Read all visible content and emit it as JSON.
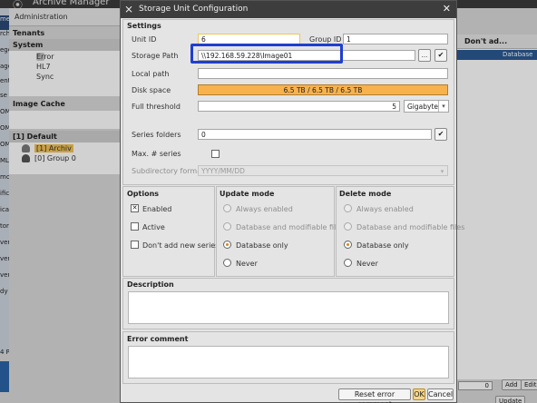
{
  "background": {
    "window_title": "Archive Manager",
    "admin_label": "Administration",
    "left_tabs": [
      "me",
      "rchive",
      "ege",
      "age",
      "ent",
      "se",
      "OM",
      "OM",
      "OM",
      "ML",
      "mor",
      "ific",
      "ica",
      "tor",
      "ver",
      "ver",
      "ver",
      "dy U"
    ],
    "tenants_label": "Tenants",
    "system_label": "System",
    "system_items": [
      "Error",
      "HL7",
      "Sync"
    ],
    "image_cache_label": "Image Cache",
    "default_label": "[1] Default",
    "tree_items": [
      "[1] Archiv",
      "[0] Group 0"
    ],
    "right_column_header": "Don't ad...",
    "right_row_value": "Database ...",
    "bottom_field_value": "0",
    "add_button": "Add",
    "edit_button": "Edit",
    "update_button": "Update",
    "side_fragment": "4 P"
  },
  "dialog": {
    "title": "Storage Unit Configuration",
    "settings": {
      "title": "Settings",
      "unit_id_label": "Unit ID",
      "unit_id_value": "6",
      "group_id_label": "Group ID",
      "group_id_value": "1",
      "storage_path_label": "Storage Path",
      "storage_path_value": "\\\\192.168.59.228\\Image01",
      "browse_button": "...",
      "local_path_label": "Local path",
      "local_path_value": "",
      "disk_space_label": "Disk space",
      "disk_space_value": "6.5 TB / 6.5 TB / 6.5 TB",
      "disk_usage_fraction": 1.0,
      "full_threshold_label": "Full threshold",
      "full_threshold_value": "5",
      "full_threshold_unit": "Gigabyte",
      "series_folders_label": "Series folders",
      "series_folders_value": "0",
      "max_series_label": "Max. # series",
      "subdirectory_format_label": "Subdirectory format",
      "subdirectory_format_value": "YYYY/MM/DD"
    },
    "options": {
      "title": "Options",
      "items": [
        {
          "label": "Enabled",
          "checked": true
        },
        {
          "label": "Active",
          "checked": false
        },
        {
          "label": "Don't add new series",
          "checked": false
        }
      ]
    },
    "update_mode": {
      "title": "Update mode",
      "items": [
        {
          "label": "Always enabled",
          "selected": false,
          "disabled": true
        },
        {
          "label": "Database and modifiable files",
          "selected": false,
          "disabled": true
        },
        {
          "label": "Database only",
          "selected": true,
          "disabled": false
        },
        {
          "label": "Never",
          "selected": false,
          "disabled": false
        }
      ]
    },
    "delete_mode": {
      "title": "Delete mode",
      "items": [
        {
          "label": "Always enabled",
          "selected": false,
          "disabled": true
        },
        {
          "label": "Database and modifiable files",
          "selected": false,
          "disabled": true
        },
        {
          "label": "Database only",
          "selected": true,
          "disabled": false
        },
        {
          "label": "Never",
          "selected": false,
          "disabled": false
        }
      ]
    },
    "description": {
      "title": "Description",
      "value": ""
    },
    "error_comment": {
      "title": "Error comment",
      "value": ""
    },
    "buttons": {
      "reset_error_comment": "Reset error comment",
      "ok": "OK",
      "cancel": "Cancel"
    },
    "colors": {
      "disk_bar": "#f7b24e",
      "highlight": "#1f3fcf",
      "titlebar": "#3d3d3d"
    }
  }
}
